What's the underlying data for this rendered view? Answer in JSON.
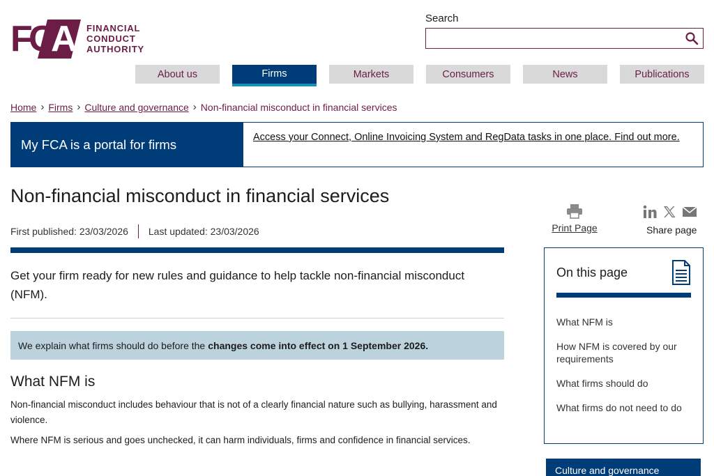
{
  "logo": {
    "letter_f": "F",
    "letter_c": "C",
    "letter_a": "A",
    "line1": "FINANCIAL",
    "line2": "CONDUCT",
    "line3": "AUTHORITY"
  },
  "search": {
    "label": "Search",
    "value": "",
    "icon": "search-icon"
  },
  "nav": {
    "items": [
      {
        "label": "About us",
        "active": false
      },
      {
        "label": "Firms",
        "active": true
      },
      {
        "label": "Markets",
        "active": false
      },
      {
        "label": "Consumers",
        "active": false
      },
      {
        "label": "News",
        "active": false
      },
      {
        "label": "Publications",
        "active": false
      }
    ]
  },
  "breadcrumb": {
    "items": [
      "Home",
      "Firms",
      "Culture and governance"
    ],
    "current": "Non-financial misconduct in financial services",
    "separator_icon": "chevron-right-icon"
  },
  "portal": {
    "title": "My FCA is a portal for firms",
    "link": "Access your Connect, Online Invoicing System and RegData tasks in one place. Find out more."
  },
  "page": {
    "title": "Non-financial misconduct in financial services",
    "first_published": "First published: 23/03/2026",
    "last_updated": "Last updated: 23/03/2026",
    "intro": "Get your firm ready for new rules and guidance to help tackle non-financial misconduct (NFM).",
    "notice_text": "We explain what firms should do before the",
    "notice_bold": "changes come into effect on 1 September 2026.",
    "section_heading": "What NFM is",
    "para1": "Non-financial misconduct includes behaviour that is not of a clearly financial nature such as bullying, harassment and violence.",
    "para2": "Where NFM is serious and goes unchecked, it can harm individuals, firms and confidence in financial services."
  },
  "tools": {
    "print_label": "Print Page",
    "print_icon": "printer-icon",
    "share_label": "Share page",
    "share_icons": [
      "linkedin-icon",
      "x-icon",
      "email-icon"
    ]
  },
  "on_this_page": {
    "title": "On this page",
    "icon": "document-icon",
    "items": [
      "What NFM is",
      "How NFM is covered by our requirements",
      "What firms should do",
      "What firms do not need to do"
    ]
  },
  "related_tab": {
    "label": "Culture and governance"
  },
  "colors": {
    "brand": "#6b1d46",
    "navy": "#003c78",
    "notice_bg": "#bcd2dd",
    "nav_bg": "#d9d9d9"
  }
}
